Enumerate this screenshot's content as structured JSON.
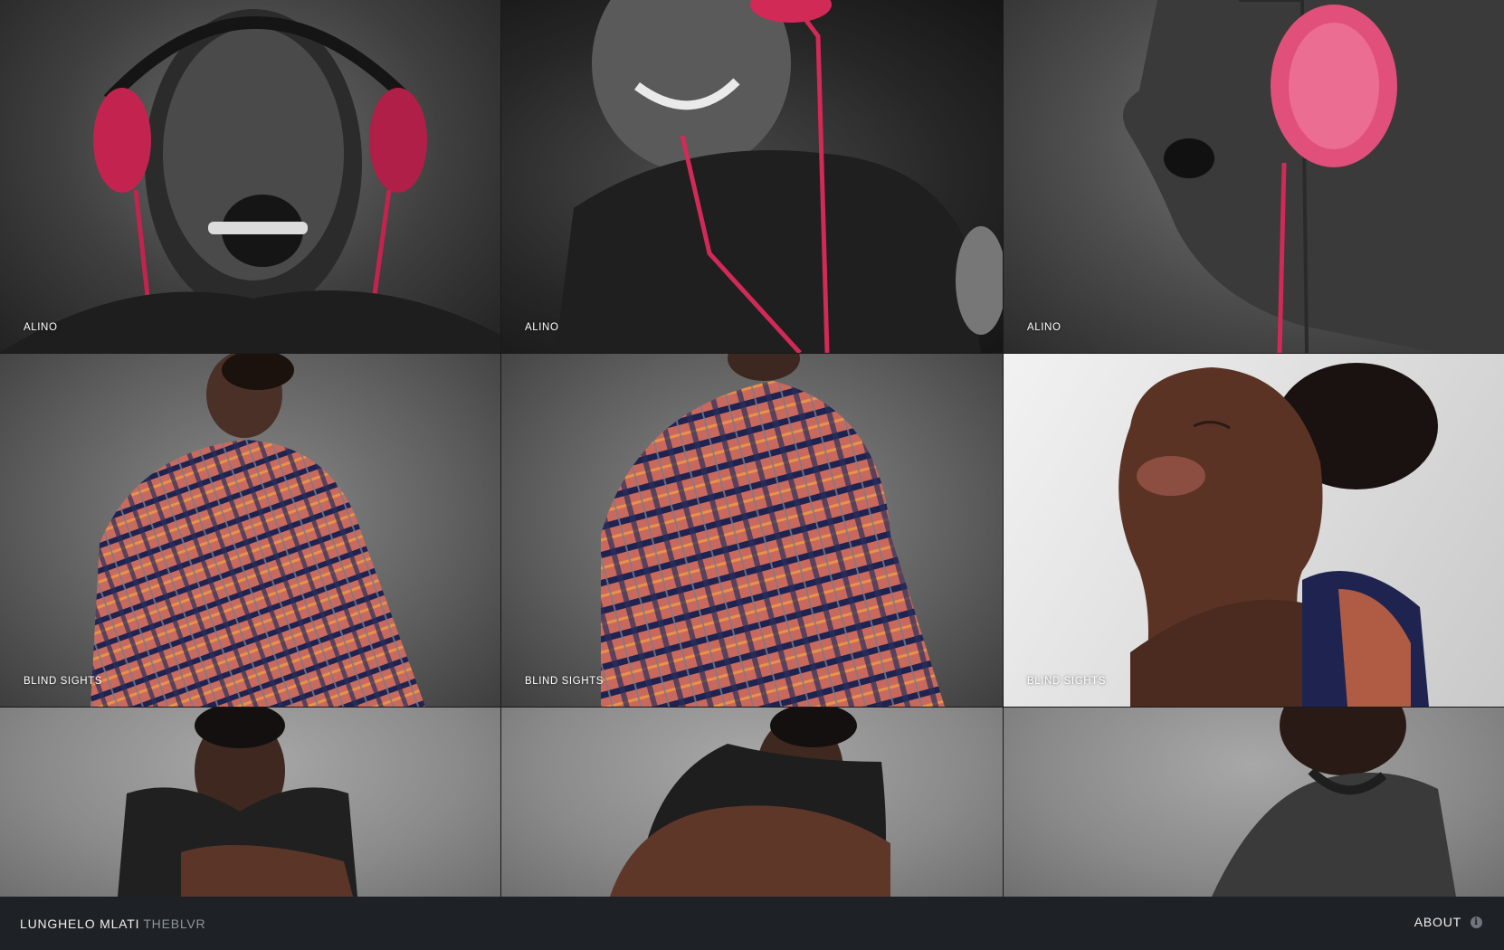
{
  "gallery": {
    "tiles": [
      {
        "caption": "ALINO"
      },
      {
        "caption": "ALINO"
      },
      {
        "caption": "ALINO"
      },
      {
        "caption": "BLIND SIGHTS"
      },
      {
        "caption": "BLIND SIGHTS"
      },
      {
        "caption": "BLIND SIGHTS"
      },
      {
        "caption": ""
      },
      {
        "caption": ""
      },
      {
        "caption": ""
      }
    ]
  },
  "footer": {
    "name": "LUNGHELO MLATI",
    "handle": "THEBLVR",
    "about_label": "ABOUT",
    "about_icon": "info-icon"
  },
  "colors": {
    "footer_bg": "#1e2226",
    "accent_headphones": "#d9345f",
    "handle_grey": "#8f959a"
  }
}
